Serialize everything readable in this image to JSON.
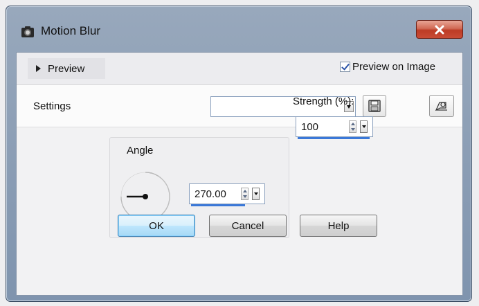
{
  "window": {
    "title": "Motion Blur",
    "close_glyph": "✕"
  },
  "preview": {
    "toggle_label": "Preview",
    "preview_on_image_label": "Preview on Image",
    "preview_on_image_checked": true
  },
  "settings": {
    "label": "Settings",
    "preset_value": "",
    "save_icon": "save-icon",
    "preset_icon": "preset-manager-icon"
  },
  "angle": {
    "label": "Angle",
    "value": "270.00"
  },
  "strength": {
    "label": "Strength (%):",
    "value": "100"
  },
  "buttons": {
    "ok": "OK",
    "cancel": "Cancel",
    "help": "Help"
  },
  "colors": {
    "titlebar": "#8a9db5",
    "close": "#c84b35",
    "accent_underline": "#3a78d8"
  }
}
